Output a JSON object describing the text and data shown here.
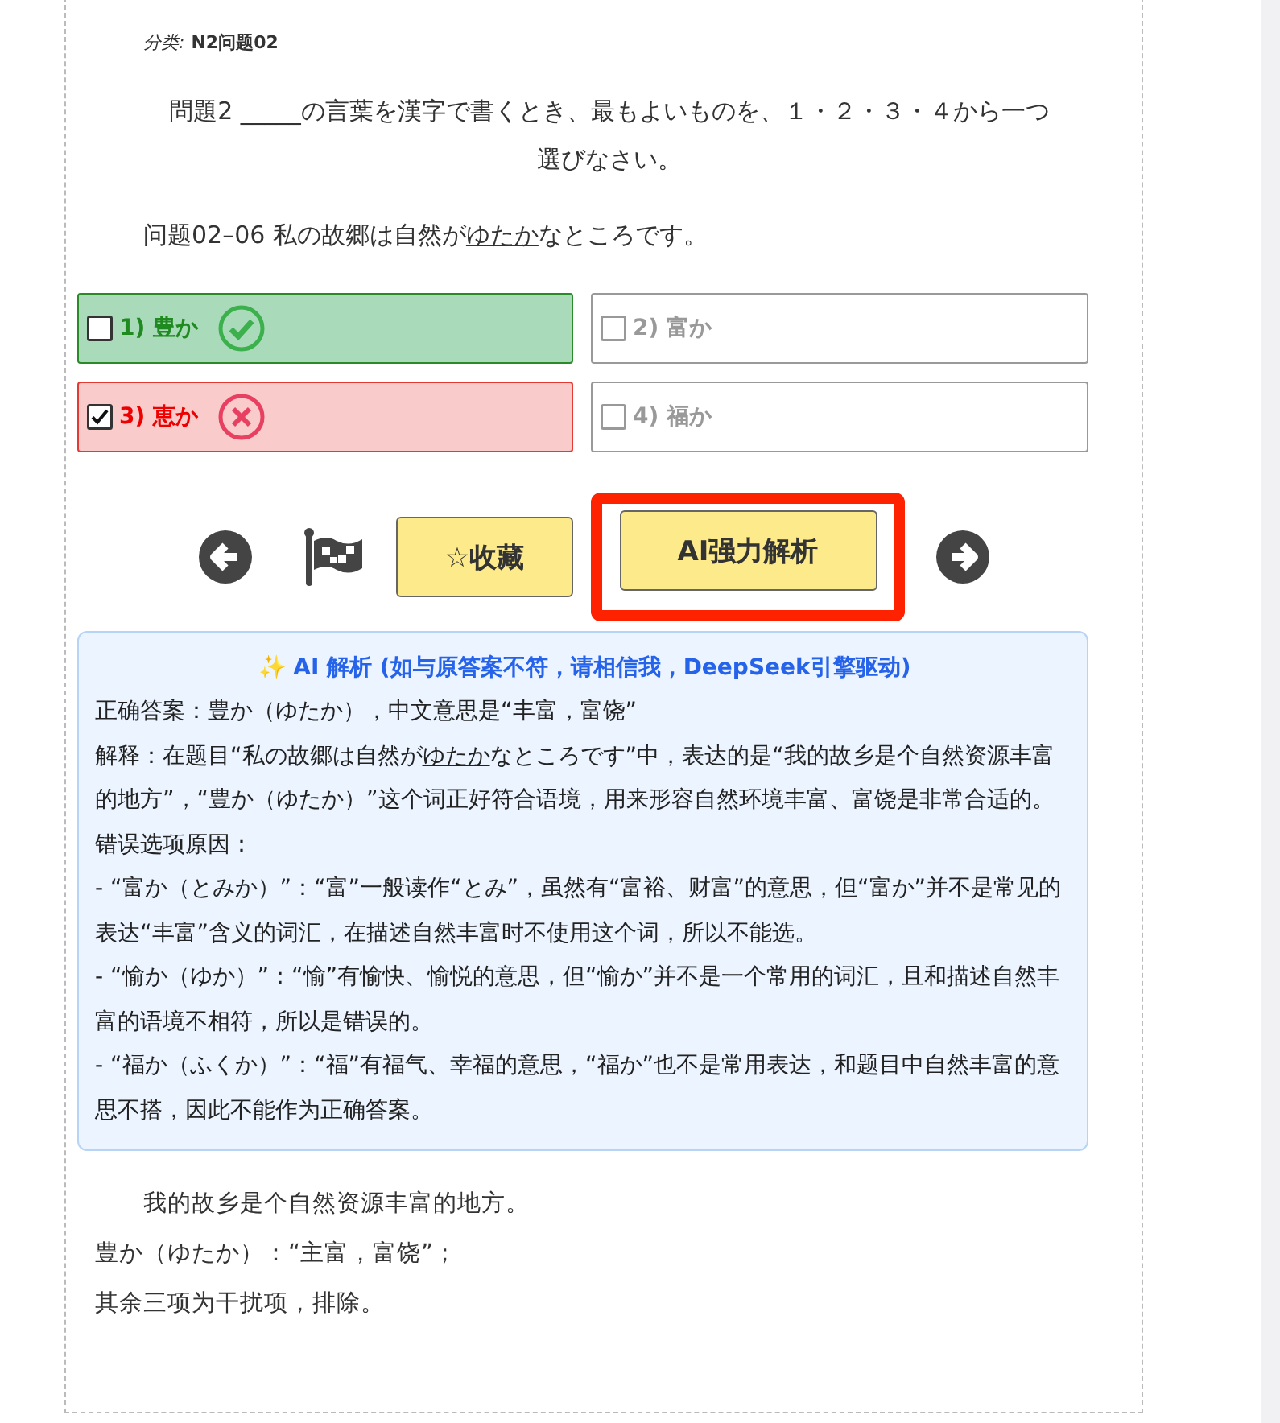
{
  "category": {
    "label": "分类:",
    "value": "N2问题02"
  },
  "instruction": "問題2 _____の言葉を漢字で書くとき、最もよいものを、１・２・３・４から一つ選びなさい。",
  "question": {
    "before": "问题02–06 私の故郷は自然が",
    "underlined": "ゆたか",
    "after": "なところです。"
  },
  "options": [
    {
      "label": "1) 豊か",
      "checked": false,
      "kind": "correct"
    },
    {
      "label": "2) 富か",
      "checked": false,
      "kind": "neutral"
    },
    {
      "label": "3) 恵か",
      "checked": true,
      "kind": "wrong"
    },
    {
      "label": "4) 福か",
      "checked": false,
      "kind": "neutral"
    }
  ],
  "actions": {
    "favorite": "☆收藏",
    "ai": "AI强力解析",
    "ai_highlighted": true
  },
  "ai_panel": {
    "title": "✨ AI 解析 (如与原答案不符，请相信我，DeepSeek引擎驱动)",
    "lines": [
      {
        "before": "正确答案：豊か（ゆたか），中文意思是“丰富，富饶”"
      },
      {
        "before": "解释：在题目“私の故郷は自然が",
        "underlined": "ゆたか",
        "after": "なところです”中，表达的是“我的故乡是个自然资源丰富的地方”，“豊か（ゆたか）”这个词正好符合语境，用来形容自然环境丰富、富饶是非常合适的。"
      },
      {
        "before": "错误选项原因："
      },
      {
        "before": "- “富か（とみか）”：“富”一般读作“とみ”，虽然有“富裕、财富”的意思，但“富か”并不是常见的表达“丰富”含义的词汇，在描述自然丰富时不使用这个词，所以不能选。"
      },
      {
        "before": "- “愉か（ゆか）”：“愉”有愉快、愉悦的意思，但“愉か”并不是一个常用的词汇，且和描述自然丰富的语境不相符，所以是错误的。"
      },
      {
        "before": "- “福か（ふくか）”：“福”有福气、幸福的意思，“福か”也不是常用表达，和题目中自然丰富的意思不搭，因此不能作为正确答案。"
      }
    ]
  },
  "notes": {
    "lead": "我的故乡是个自然资源丰富的地方。",
    "lines": [
      "豊か（ゆたか）：“主富，富饶”；",
      "其余三项为干扰项，排除。"
    ]
  }
}
